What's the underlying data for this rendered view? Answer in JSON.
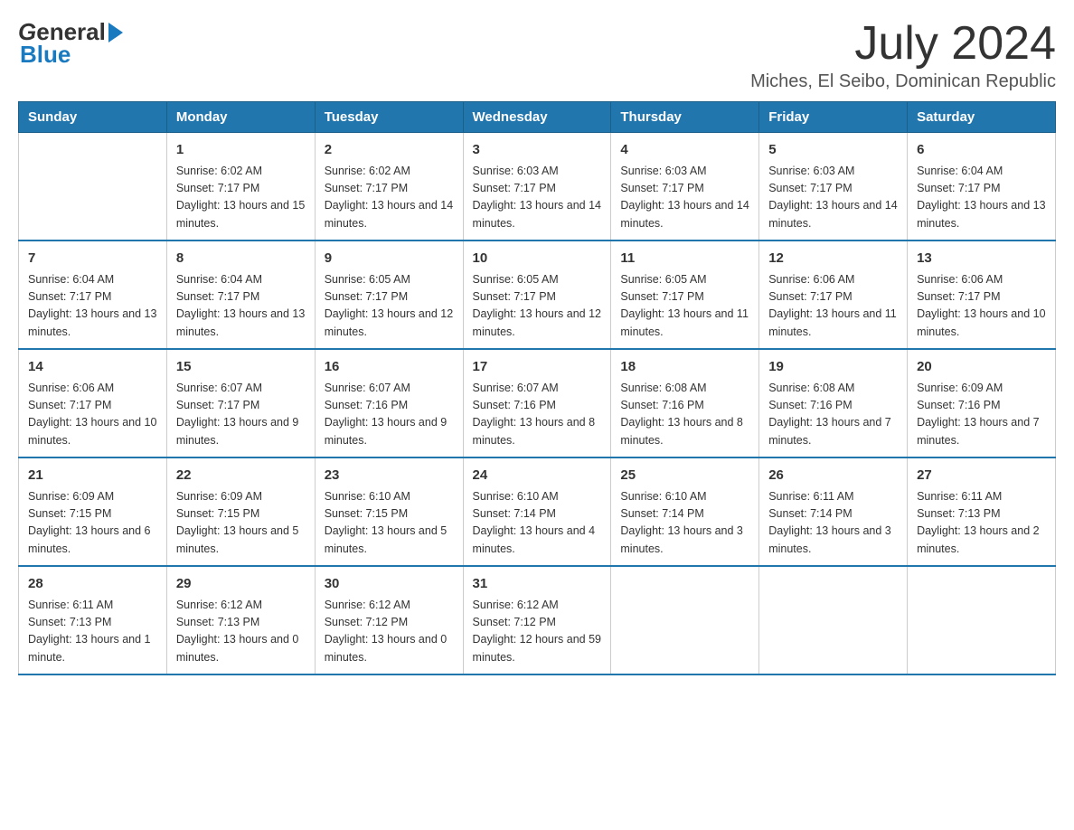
{
  "header": {
    "logo_text_black": "General",
    "logo_text_blue": "Blue",
    "main_title": "July 2024",
    "subtitle": "Miches, El Seibo, Dominican Republic"
  },
  "calendar": {
    "days_of_week": [
      "Sunday",
      "Monday",
      "Tuesday",
      "Wednesday",
      "Thursday",
      "Friday",
      "Saturday"
    ],
    "weeks": [
      [
        {
          "day": "",
          "sunrise": "",
          "sunset": "",
          "daylight": ""
        },
        {
          "day": "1",
          "sunrise": "Sunrise: 6:02 AM",
          "sunset": "Sunset: 7:17 PM",
          "daylight": "Daylight: 13 hours and 15 minutes."
        },
        {
          "day": "2",
          "sunrise": "Sunrise: 6:02 AM",
          "sunset": "Sunset: 7:17 PM",
          "daylight": "Daylight: 13 hours and 14 minutes."
        },
        {
          "day": "3",
          "sunrise": "Sunrise: 6:03 AM",
          "sunset": "Sunset: 7:17 PM",
          "daylight": "Daylight: 13 hours and 14 minutes."
        },
        {
          "day": "4",
          "sunrise": "Sunrise: 6:03 AM",
          "sunset": "Sunset: 7:17 PM",
          "daylight": "Daylight: 13 hours and 14 minutes."
        },
        {
          "day": "5",
          "sunrise": "Sunrise: 6:03 AM",
          "sunset": "Sunset: 7:17 PM",
          "daylight": "Daylight: 13 hours and 14 minutes."
        },
        {
          "day": "6",
          "sunrise": "Sunrise: 6:04 AM",
          "sunset": "Sunset: 7:17 PM",
          "daylight": "Daylight: 13 hours and 13 minutes."
        }
      ],
      [
        {
          "day": "7",
          "sunrise": "Sunrise: 6:04 AM",
          "sunset": "Sunset: 7:17 PM",
          "daylight": "Daylight: 13 hours and 13 minutes."
        },
        {
          "day": "8",
          "sunrise": "Sunrise: 6:04 AM",
          "sunset": "Sunset: 7:17 PM",
          "daylight": "Daylight: 13 hours and 13 minutes."
        },
        {
          "day": "9",
          "sunrise": "Sunrise: 6:05 AM",
          "sunset": "Sunset: 7:17 PM",
          "daylight": "Daylight: 13 hours and 12 minutes."
        },
        {
          "day": "10",
          "sunrise": "Sunrise: 6:05 AM",
          "sunset": "Sunset: 7:17 PM",
          "daylight": "Daylight: 13 hours and 12 minutes."
        },
        {
          "day": "11",
          "sunrise": "Sunrise: 6:05 AM",
          "sunset": "Sunset: 7:17 PM",
          "daylight": "Daylight: 13 hours and 11 minutes."
        },
        {
          "day": "12",
          "sunrise": "Sunrise: 6:06 AM",
          "sunset": "Sunset: 7:17 PM",
          "daylight": "Daylight: 13 hours and 11 minutes."
        },
        {
          "day": "13",
          "sunrise": "Sunrise: 6:06 AM",
          "sunset": "Sunset: 7:17 PM",
          "daylight": "Daylight: 13 hours and 10 minutes."
        }
      ],
      [
        {
          "day": "14",
          "sunrise": "Sunrise: 6:06 AM",
          "sunset": "Sunset: 7:17 PM",
          "daylight": "Daylight: 13 hours and 10 minutes."
        },
        {
          "day": "15",
          "sunrise": "Sunrise: 6:07 AM",
          "sunset": "Sunset: 7:17 PM",
          "daylight": "Daylight: 13 hours and 9 minutes."
        },
        {
          "day": "16",
          "sunrise": "Sunrise: 6:07 AM",
          "sunset": "Sunset: 7:16 PM",
          "daylight": "Daylight: 13 hours and 9 minutes."
        },
        {
          "day": "17",
          "sunrise": "Sunrise: 6:07 AM",
          "sunset": "Sunset: 7:16 PM",
          "daylight": "Daylight: 13 hours and 8 minutes."
        },
        {
          "day": "18",
          "sunrise": "Sunrise: 6:08 AM",
          "sunset": "Sunset: 7:16 PM",
          "daylight": "Daylight: 13 hours and 8 minutes."
        },
        {
          "day": "19",
          "sunrise": "Sunrise: 6:08 AM",
          "sunset": "Sunset: 7:16 PM",
          "daylight": "Daylight: 13 hours and 7 minutes."
        },
        {
          "day": "20",
          "sunrise": "Sunrise: 6:09 AM",
          "sunset": "Sunset: 7:16 PM",
          "daylight": "Daylight: 13 hours and 7 minutes."
        }
      ],
      [
        {
          "day": "21",
          "sunrise": "Sunrise: 6:09 AM",
          "sunset": "Sunset: 7:15 PM",
          "daylight": "Daylight: 13 hours and 6 minutes."
        },
        {
          "day": "22",
          "sunrise": "Sunrise: 6:09 AM",
          "sunset": "Sunset: 7:15 PM",
          "daylight": "Daylight: 13 hours and 5 minutes."
        },
        {
          "day": "23",
          "sunrise": "Sunrise: 6:10 AM",
          "sunset": "Sunset: 7:15 PM",
          "daylight": "Daylight: 13 hours and 5 minutes."
        },
        {
          "day": "24",
          "sunrise": "Sunrise: 6:10 AM",
          "sunset": "Sunset: 7:14 PM",
          "daylight": "Daylight: 13 hours and 4 minutes."
        },
        {
          "day": "25",
          "sunrise": "Sunrise: 6:10 AM",
          "sunset": "Sunset: 7:14 PM",
          "daylight": "Daylight: 13 hours and 3 minutes."
        },
        {
          "day": "26",
          "sunrise": "Sunrise: 6:11 AM",
          "sunset": "Sunset: 7:14 PM",
          "daylight": "Daylight: 13 hours and 3 minutes."
        },
        {
          "day": "27",
          "sunrise": "Sunrise: 6:11 AM",
          "sunset": "Sunset: 7:13 PM",
          "daylight": "Daylight: 13 hours and 2 minutes."
        }
      ],
      [
        {
          "day": "28",
          "sunrise": "Sunrise: 6:11 AM",
          "sunset": "Sunset: 7:13 PM",
          "daylight": "Daylight: 13 hours and 1 minute."
        },
        {
          "day": "29",
          "sunrise": "Sunrise: 6:12 AM",
          "sunset": "Sunset: 7:13 PM",
          "daylight": "Daylight: 13 hours and 0 minutes."
        },
        {
          "day": "30",
          "sunrise": "Sunrise: 6:12 AM",
          "sunset": "Sunset: 7:12 PM",
          "daylight": "Daylight: 13 hours and 0 minutes."
        },
        {
          "day": "31",
          "sunrise": "Sunrise: 6:12 AM",
          "sunset": "Sunset: 7:12 PM",
          "daylight": "Daylight: 12 hours and 59 minutes."
        },
        {
          "day": "",
          "sunrise": "",
          "sunset": "",
          "daylight": ""
        },
        {
          "day": "",
          "sunrise": "",
          "sunset": "",
          "daylight": ""
        },
        {
          "day": "",
          "sunrise": "",
          "sunset": "",
          "daylight": ""
        }
      ]
    ]
  }
}
